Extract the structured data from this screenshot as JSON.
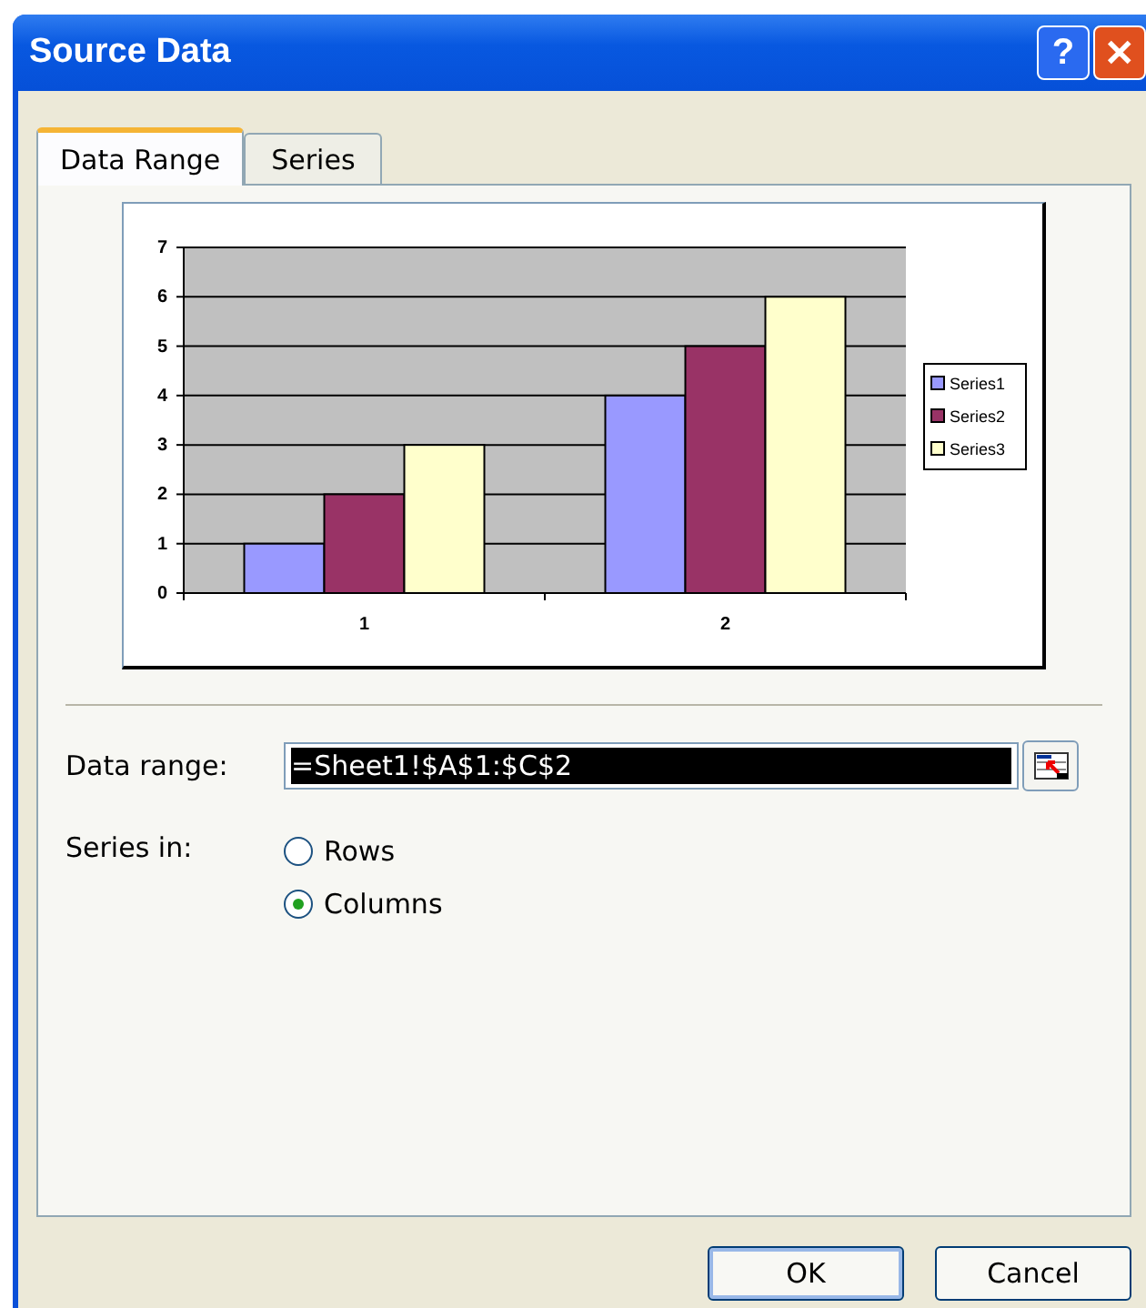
{
  "window": {
    "title": "Source Data"
  },
  "title_buttons": [
    {
      "kind": "help",
      "label": "?"
    },
    {
      "kind": "close",
      "label": "✕"
    }
  ],
  "tabs": [
    {
      "label": "Data Range",
      "selected": true
    },
    {
      "label": "Series",
      "selected": false
    }
  ],
  "chart_data": {
    "type": "bar",
    "grid": true,
    "legend": "right",
    "categories": [
      "1",
      "2"
    ],
    "ylim": [
      0,
      7
    ],
    "yticks": [
      0,
      1,
      2,
      3,
      4,
      5,
      6,
      7
    ],
    "series": [
      {
        "name": "Series1",
        "color": "#9999ff",
        "values": [
          1,
          4
        ]
      },
      {
        "name": "Series2",
        "color": "#993366",
        "values": [
          2,
          5
        ]
      },
      {
        "name": "Series3",
        "color": "#ffffcc",
        "values": [
          3,
          6
        ]
      }
    ]
  },
  "data_range": {
    "label": "Data range:",
    "value": "=Sheet1!$A$1:$C$2"
  },
  "series_in": {
    "label": "Series in:",
    "options": [
      {
        "label": "Rows",
        "selected": false
      },
      {
        "label": "Columns",
        "selected": true
      }
    ]
  },
  "buttons": [
    "OK",
    "Cancel"
  ]
}
